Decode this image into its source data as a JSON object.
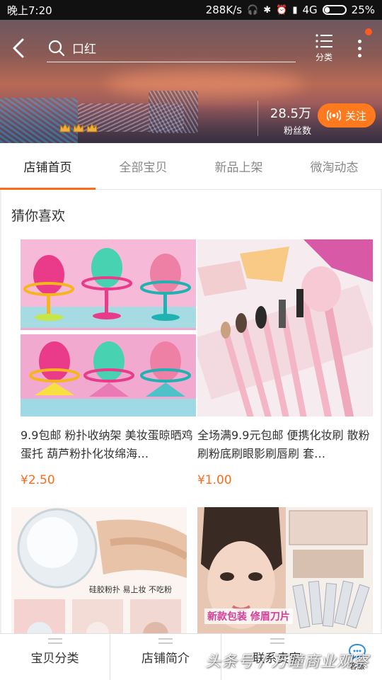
{
  "status_bar": {
    "time": "晚上7:20",
    "speed": "288K/s",
    "network": "4G",
    "battery": "25%",
    "battery_level": 0.25
  },
  "header": {
    "search_query": "口红",
    "category_label": "分类",
    "fans_count": "28.5万",
    "fans_label": "粉丝数",
    "follow_label": "关注"
  },
  "tabs": [
    {
      "label": "店铺首页",
      "active": true
    },
    {
      "label": "全部宝贝",
      "active": false
    },
    {
      "label": "新品上架",
      "active": false
    },
    {
      "label": "微淘动态",
      "active": false
    }
  ],
  "section": {
    "title": "猜你喜欢"
  },
  "products": [
    {
      "title": "9.9包邮 粉扑收纳架 美妆蛋晾晒鸡蛋托 葫芦粉扑化妆绵海…",
      "price": "¥2.50",
      "image": "makeup-sponge-holders"
    },
    {
      "title": "全场满9.9元包邮 便携化妆刷 散粉刷粉底刷眼影刷唇刷 套…",
      "price": "¥1.00",
      "image": "pink-makeup-brushes"
    },
    {
      "title": "",
      "price": "",
      "image": "silicone-puff",
      "caption": "硅胶粉扑 易上妆 不吃粉"
    },
    {
      "title": "",
      "price": "",
      "image": "eyebrow-razor",
      "caption": "新款包装 修眉刀片"
    }
  ],
  "bottom_nav": {
    "item1": "宝贝分类",
    "item2": "店铺简介",
    "item3": "联系卖家",
    "service_label": "客服"
  },
  "watermark": "头条号 / 万瞳商业观察",
  "colors": {
    "accent": "#ff6a1a",
    "follow_button": "#ff7a1e",
    "price": "#ff6a1a",
    "notification_dot": "#ff5a1f"
  }
}
